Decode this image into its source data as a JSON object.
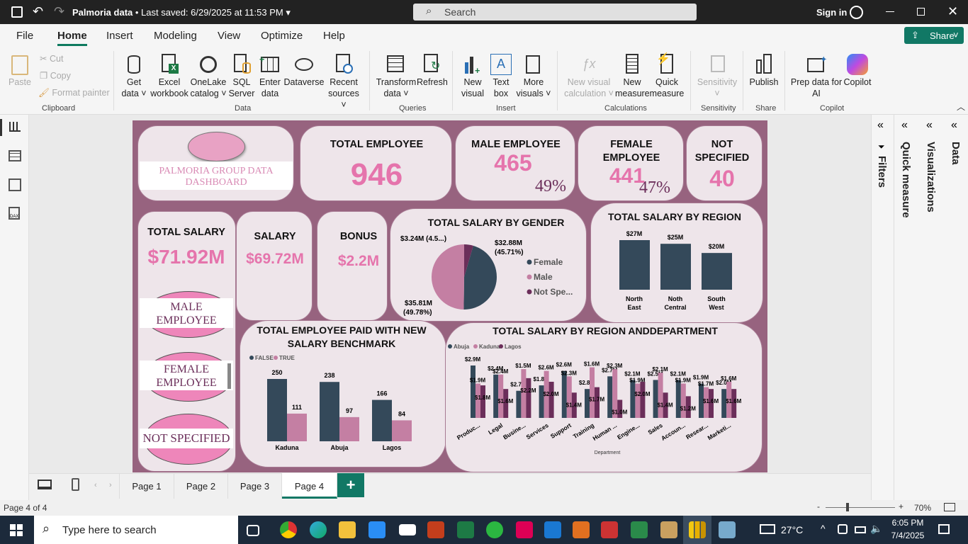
{
  "titlebar": {
    "doc_title": "Palmoria data",
    "saved": "• Last saved: 6/29/2025 at 11:53 PM",
    "search_placeholder": "Search",
    "sign_in": "Sign in"
  },
  "menu": {
    "items": [
      "File",
      "Home",
      "Insert",
      "Modeling",
      "View",
      "Optimize",
      "Help"
    ],
    "share": "Share"
  },
  "ribbon": {
    "clipboard": {
      "paste": "Paste",
      "cut": "Cut",
      "copy": "Copy",
      "format_painter": "Format painter",
      "group": "Clipboard"
    },
    "data": {
      "get_data": [
        "Get",
        "data ˅"
      ],
      "excel": [
        "Excel",
        "workbook"
      ],
      "onelake": [
        "OneLake",
        "catalog ˅"
      ],
      "sql": [
        "SQL",
        "Server"
      ],
      "enter": [
        "Enter",
        "data"
      ],
      "dataverse": [
        "Dataverse",
        ""
      ],
      "recent": [
        "Recent",
        "sources ˅"
      ],
      "group": "Data"
    },
    "queries": {
      "transform": [
        "Transform",
        "data ˅"
      ],
      "refresh": [
        "Refresh",
        ""
      ],
      "group": "Queries"
    },
    "insert": {
      "new_visual": [
        "New",
        "visual"
      ],
      "text_box": [
        "Text",
        "box"
      ],
      "more": [
        "More",
        "visuals ˅"
      ],
      "group": "Insert"
    },
    "calc": {
      "nvc": [
        "New visual",
        "calculation ˅"
      ],
      "nm": [
        "New",
        "measure"
      ],
      "qm": [
        "Quick",
        "measure"
      ],
      "group": "Calculations"
    },
    "sensitivity": {
      "label": [
        "Sensitivity",
        "˅"
      ],
      "group": "Sensitivity"
    },
    "share": {
      "publish": "Publish",
      "group": "Share"
    },
    "copilot": {
      "prep": [
        "Prep data for",
        "AI"
      ],
      "copilot": "Copilot",
      "group": "Copilot"
    }
  },
  "dashboard": {
    "logo_text": "PALMORIA GROUP DATA DASHBOARD",
    "total_employee": {
      "title": "TOTAL EMPLOYEE",
      "value": "946"
    },
    "male": {
      "title": "MALE EMPLOYEE",
      "value": "465",
      "pct": "49%"
    },
    "female": {
      "title": [
        "FEMALE",
        "EMPLOYEE"
      ],
      "value": "441",
      "pct": "47%"
    },
    "not_specified": {
      "title": [
        "NOT",
        "SPECIFIED"
      ],
      "value": "40"
    },
    "total_salary": {
      "title": "TOTAL SALARY",
      "value": "$71.92M"
    },
    "salary": {
      "title": "SALARY",
      "value": "$69.72M"
    },
    "bonus": {
      "title": "BONUS",
      "value": "$2.2M"
    },
    "buttons": {
      "male": [
        "MALE",
        "EMPLOYEE"
      ],
      "female": [
        "FEMALE",
        "EMPLOYEE"
      ],
      "ns": "NOT SPECIFIED"
    }
  },
  "chart_data": [
    {
      "type": "pie",
      "title": "TOTAL SALARY BY GENDER",
      "slices": [
        {
          "name": "Female",
          "value": 32.88,
          "label": "$32.88M",
          "pct": "(45.71%)",
          "color": "#34495a"
        },
        {
          "name": "Male",
          "value": 35.81,
          "label": "$35.81M",
          "pct": "(49.78%)",
          "color": "#c47fa3"
        },
        {
          "name": "Not Spe...",
          "value": 3.24,
          "label": "$3.24M (4.5...)",
          "pct": "",
          "color": "#6b2e5a"
        }
      ],
      "legend": [
        "Female",
        "Male",
        "Not Spe..."
      ]
    },
    {
      "type": "bar",
      "title": "TOTAL SALARY BY REGION",
      "categories": [
        [
          "North",
          "East"
        ],
        [
          "Noth",
          "Central"
        ],
        [
          "South",
          "West"
        ]
      ],
      "values": [
        27,
        25,
        20
      ],
      "labels": [
        "$27M",
        "$25M",
        "$20M"
      ],
      "color": "#34495a"
    },
    {
      "type": "bar",
      "title": "TOTAL EMPLOYEE PAID WITH NEW SALARY BENCHMARK",
      "categories": [
        "Kaduna",
        "Abuja",
        "Lagos"
      ],
      "series": [
        {
          "name": "FALSE",
          "values": [
            250,
            238,
            166
          ],
          "color": "#34495a"
        },
        {
          "name": "TRUE",
          "values": [
            111,
            97,
            84
          ],
          "color": "#c47fa3"
        }
      ],
      "legend": [
        "FALSE",
        "TRUE"
      ]
    },
    {
      "type": "bar",
      "title": "TOTAL SALARY BY REGION ANDDEPARTMENT",
      "xlabel": "Department",
      "categories": [
        "Produc...",
        "Legal",
        "Busine...",
        "Services",
        "Support",
        "Training",
        "Human ...",
        "Engine...",
        "Sales",
        "Accoun...",
        "Resear...",
        "Marketi..."
      ],
      "series": [
        {
          "name": "Abuja",
          "values": [
            2.9,
            2.4,
            1.5,
            1.8,
            2.6,
            1.6,
            2.3,
            2.1,
            2.1,
            2.1,
            1.9,
            1.6
          ],
          "color": "#34495a"
        },
        {
          "name": "Kaduna",
          "values": [
            1.9,
            2.4,
            2.7,
            2.6,
            2.3,
            2.8,
            2.7,
            1.9,
            2.5,
            1.9,
            1.7,
            2.0
          ],
          "color": "#c47fa3"
        },
        {
          "name": "Lagos",
          "values": [
            1.8,
            1.6,
            2.2,
            2.0,
            1.4,
            1.7,
            1.0,
            2.0,
            1.4,
            1.2,
            1.6,
            1.6
          ],
          "color": "#6b2e5a"
        }
      ],
      "labels": [
        "$2.9M",
        "$1.9M",
        "$1.8M",
        "$2.4M",
        "$2.4M",
        "$1.6M",
        "$2.7M",
        "$1.5M",
        "$2.2M",
        "$1.8M",
        "$2.6M",
        "$2.0M",
        "$2.6M",
        "$2.3M",
        "$1.4M",
        "$2.8M",
        "$1.6M",
        "$1.7M",
        "$2.7M",
        "$2.3M",
        "$1.0M",
        "$2.1M",
        "$1.9M",
        "$2.0M",
        "$2.5M",
        "$2.1M",
        "$1.4M",
        "$2.1M",
        "$1.9M",
        "$1.2M",
        "$1.9M",
        "$1.7M",
        "$1.6M",
        "$2.0M",
        "$1.6M",
        "$1.6M"
      ],
      "legend": [
        "Abuja",
        "Kaduna",
        "Lagos"
      ]
    }
  ],
  "panes": [
    "Filters",
    "Quick measure",
    "Visualizations",
    "Data"
  ],
  "tabs": [
    "Page 1",
    "Page 2",
    "Page 3",
    "Page 4"
  ],
  "status": {
    "page": "Page 4 of 4",
    "zoom": "70%"
  },
  "taskbar": {
    "search": "Type here to search",
    "temp": "27°C",
    "time": "6:05 PM",
    "date": "7/4/2025"
  }
}
